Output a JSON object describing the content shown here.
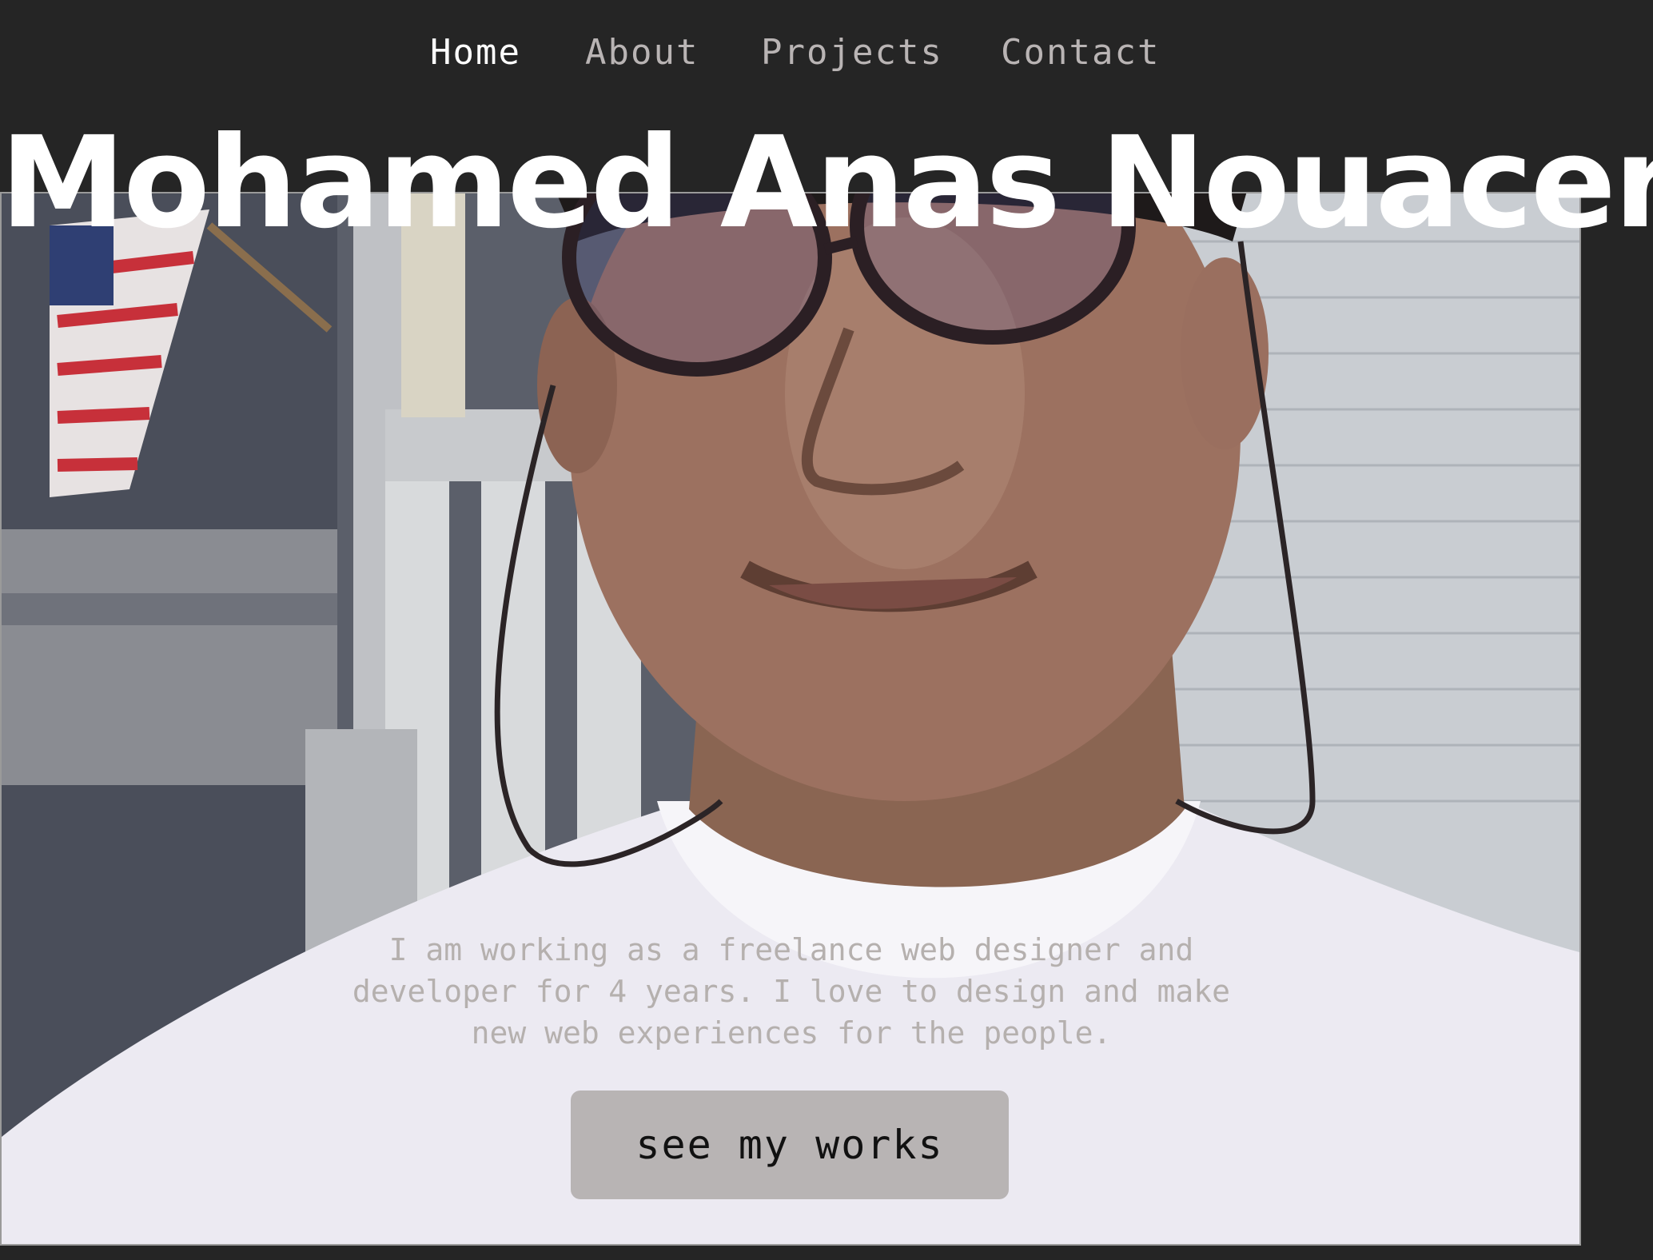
{
  "nav": {
    "items": [
      {
        "label": "Home",
        "active": true
      },
      {
        "label": "About",
        "active": false
      },
      {
        "label": "Projects",
        "active": false
      },
      {
        "label": "Contact",
        "active": false
      }
    ]
  },
  "hero": {
    "title": "Mohamed Anas Nouacer",
    "bio": "I am working as a freelance web designer and developer for 4 years. I love to design and make new web experiences for the people.",
    "cta_label": "see my works"
  },
  "colors": {
    "background": "#252525",
    "nav_active": "#ffffff",
    "nav_inactive": "#b9b4b4",
    "button_bg": "#b8b4b4",
    "bio_text": "#b5b0ae"
  }
}
